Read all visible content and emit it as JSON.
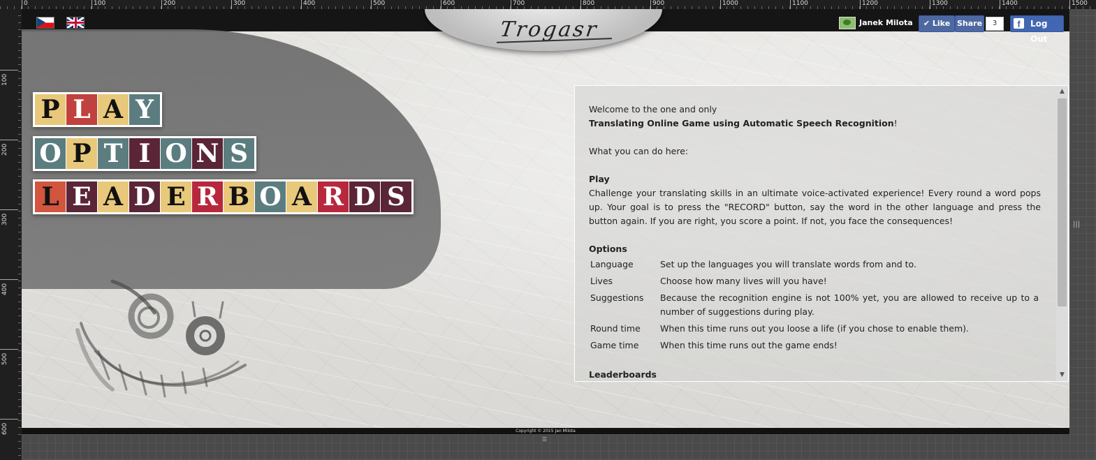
{
  "ruler": {
    "ticks": [
      "0",
      "100",
      "200",
      "300",
      "400",
      "500",
      "600",
      "700",
      "800",
      "900",
      "1000",
      "1100",
      "1200",
      "1300",
      "1400",
      "1500"
    ],
    "vticks": [
      "100",
      "200",
      "300",
      "400",
      "500",
      "600"
    ]
  },
  "header": {
    "logo": "Trogasr",
    "user_name": "Janek Milota",
    "like_label": "Like",
    "share_label": "Share",
    "share_count": "3",
    "logout_label": "Log Out"
  },
  "menu": {
    "play": [
      "P",
      "L",
      "A",
      "Y"
    ],
    "options": [
      "O",
      "P",
      "T",
      "I",
      "O",
      "N",
      "S"
    ],
    "leaderboards": [
      "L",
      "E",
      "A",
      "D",
      "E",
      "R",
      "B",
      "O",
      "A",
      "R",
      "D",
      "S"
    ]
  },
  "content": {
    "welcome_line1": "Welcome to the one and only",
    "welcome_bold": "Translating Online Game using Automatic Speech Recognition",
    "welcome_end": "!",
    "what_can": "What you can do here:",
    "play_title": "Play",
    "play_text": "Challenge your translating skills in an ultimate voice-activated experience! Every round a word pops up. Your goal is to press the \"RECORD\" button, say the word in the other language and press the button again. If you are right, you score a point. If not, you face the consequences!",
    "options_title": "Options",
    "options": [
      {
        "key": "Language",
        "value": "Set up the languages you will translate words from and to."
      },
      {
        "key": "Lives",
        "value": "Choose how many lives will you have!"
      },
      {
        "key": "Suggestions",
        "value": "Because the recognition engine is not 100% yet, you are allowed to receive up to a number of suggestions during play."
      },
      {
        "key": "Round time",
        "value": "When this time runs out you loose a life (if you chose to enable them)."
      },
      {
        "key": "Game time",
        "value": "When this time runs out the game ends!"
      }
    ],
    "leaderboards_title": "Leaderboards"
  },
  "footer": {
    "copyright": "Copyright © 2015 Jan Milota"
  },
  "colors": {
    "tile_yellow": "#e8c87a",
    "tile_teal": "#5b7d7f",
    "tile_red": "#c0413d",
    "tile_maroon": "#5a2536",
    "tile_crimson": "#b8283d",
    "tile_orange": "#d2553e"
  }
}
